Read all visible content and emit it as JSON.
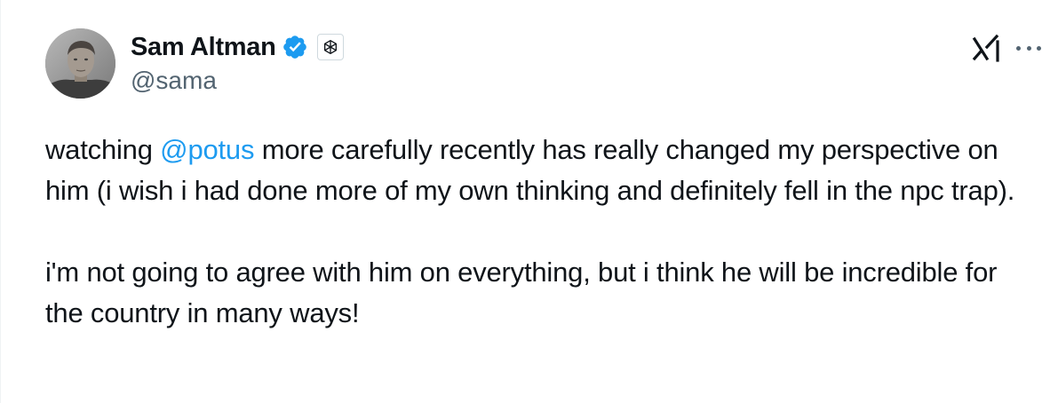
{
  "author": {
    "display_name": "Sam Altman",
    "handle": "@sama",
    "verified": true,
    "verified_icon": "verified-badge-icon",
    "affiliate_icon": "openai-logo-icon"
  },
  "header_actions": {
    "grok_icon": "grok-icon",
    "more_icon": "more-options-icon"
  },
  "tweet": {
    "para1_before": "watching ",
    "mention": "@potus",
    "para1_after": " more carefully recently has really changed my perspective on him (i wish i had done more of my own thinking and definitely fell in the npc trap).",
    "para2": "i'm not going to agree with him on everything, but i think he will be incredible for the country in many ways!"
  },
  "colors": {
    "link": "#1d9bf0",
    "verified": "#1d9bf0",
    "text": "#0f1419",
    "secondary": "#536471"
  }
}
